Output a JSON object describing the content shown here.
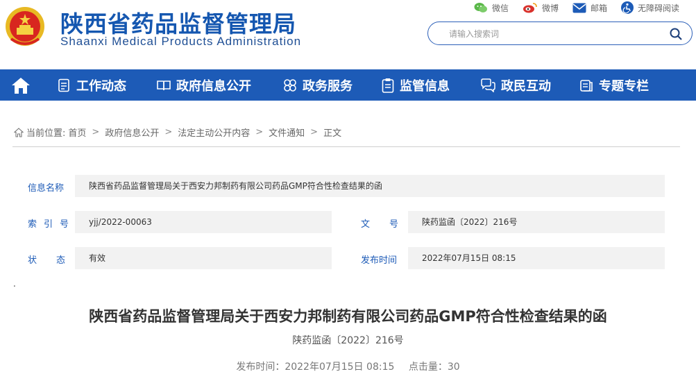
{
  "header": {
    "title_cn": "陕西省药品监督管理局",
    "title_en": "Shaanxi Medical Products Administration",
    "top_links": [
      {
        "label": "微信",
        "icon": "wechat-icon",
        "color": "#5bb84a"
      },
      {
        "label": "微博",
        "icon": "weibo-icon",
        "color": "#d9322c"
      },
      {
        "label": "邮箱",
        "icon": "mail-icon",
        "color": "#1d5bb7"
      },
      {
        "label": "无障碍阅读",
        "icon": "accessibility-icon",
        "color": "#1d5bb7"
      }
    ],
    "search": {
      "placeholder": "请输入搜索词"
    }
  },
  "nav": {
    "home_icon": "home-icon",
    "items": [
      {
        "label": "工作动态",
        "icon": "document-list-icon"
      },
      {
        "label": "政府信息公开",
        "icon": "book-icon"
      },
      {
        "label": "政务服务",
        "icon": "grid-flower-icon"
      },
      {
        "label": "监管信息",
        "icon": "clipboard-icon"
      },
      {
        "label": "政民互动",
        "icon": "chat-bubbles-icon"
      },
      {
        "label": "专题专栏",
        "icon": "folder-icon"
      }
    ]
  },
  "breadcrumb": {
    "prefix": "当前位置:",
    "items": [
      "首页",
      "政府信息公开",
      "法定主动公开内容",
      "文件通知",
      "正文"
    ]
  },
  "info": {
    "name_label": "信息名称",
    "name_value": "陕西省药品监督管理局关于西安力邦制药有限公司药品GMP符合性检查结果的函",
    "index_label": "索引号",
    "index_value": "yjj/2022-00063",
    "docno_label": "文号",
    "docno_value": "陕药监函〔2022〕216号",
    "status_label": "状态",
    "status_value": "有效",
    "date_label": "发布时间",
    "date_value": "2022年07月15日 08:15"
  },
  "article": {
    "marker": ".",
    "title": "陕西省药品监督管理局关于西安力邦制药有限公司药品GMP符合性检查结果的函",
    "doc_number": "陕药监函〔2022〕216号",
    "publish_text": "发布时间：2022年07月15日 08:15",
    "clicks_text": "点击量：30"
  },
  "colors": {
    "brand_blue": "#1d5bb7",
    "title_blue": "#1557b0",
    "field_bg": "#f2f2f2"
  }
}
